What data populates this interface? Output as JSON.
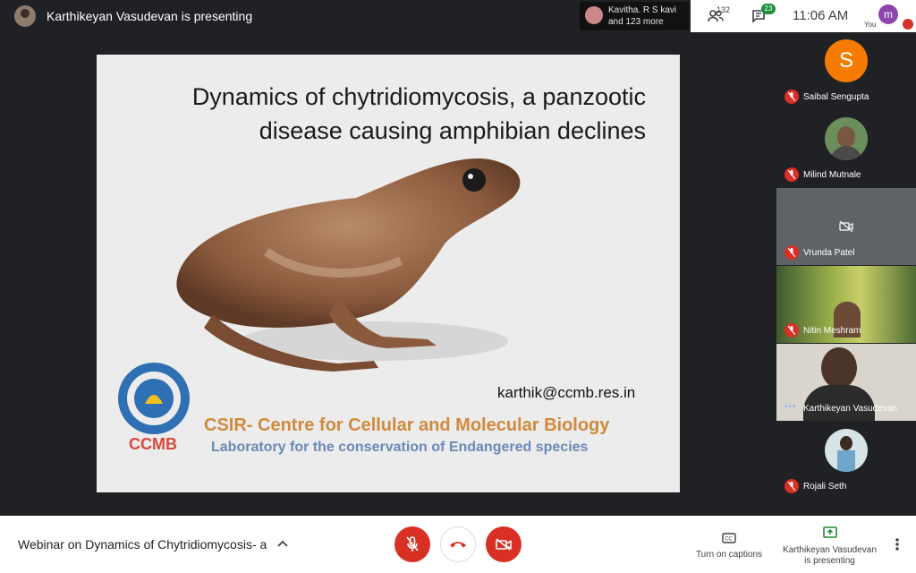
{
  "topbar": {
    "presenting_text": "Karthikeyan Vasudevan is presenting",
    "participants_preview_line1": "Kavitha. R S kavi",
    "participants_preview_line2": "and 123 more",
    "people_count": "132",
    "chat_count": "23",
    "clock": "11:06 AM",
    "you_initial": "m",
    "you_label": "You"
  },
  "slide": {
    "title_line1": "Dynamics of chytridiomycosis, a panzootic",
    "title_line2": "disease causing amphibian declines",
    "email": "karthik@ccmb.res.in",
    "org": "CSIR- Centre for Cellular and Molecular Biology",
    "lab": "Laboratory for the conservation of Endangered species",
    "logo_text": "CCMB"
  },
  "participants": [
    {
      "name": "Saibal Sengupta",
      "initial": "S",
      "muted": true
    },
    {
      "name": "Milind Mutnale",
      "muted": true
    },
    {
      "name": "Vrunda Patel",
      "muted": true
    },
    {
      "name": "Nitin Meshram",
      "muted": true
    },
    {
      "name": "Karthikeyan Vasudevan",
      "muted": false
    },
    {
      "name": "Rojali Seth",
      "muted": true
    }
  ],
  "bottombar": {
    "meeting_title": "Webinar on Dynamics of Chytridiomycosis- a p...",
    "captions_label": "Turn on captions",
    "present_line1": "Karthikeyan Vasudevan",
    "present_line2": "is presenting"
  },
  "colors": {
    "danger": "#d93025",
    "accent_green": "#1e8e3e",
    "avatar_orange": "#f57c00"
  }
}
